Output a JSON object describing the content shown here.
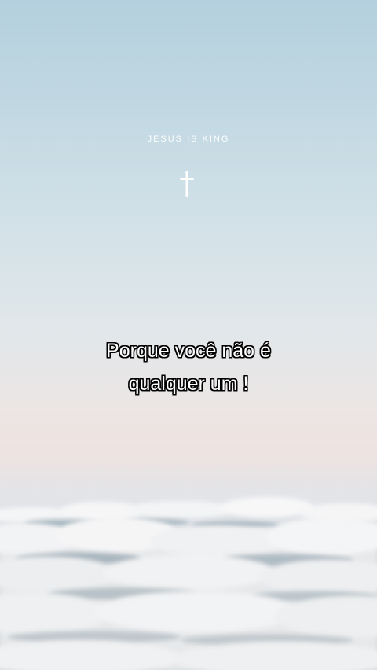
{
  "brand": {
    "text": "JESUS IS KING"
  },
  "caption": {
    "line1": "Porque você não é",
    "line2": "qualquer um !"
  },
  "icons": {
    "cross": "cross-icon"
  },
  "colors": {
    "sky_top": "#b4d0de",
    "sky_horizon": "#eee3e0",
    "caption_text": "#ffffff",
    "caption_outline": "#000000"
  }
}
